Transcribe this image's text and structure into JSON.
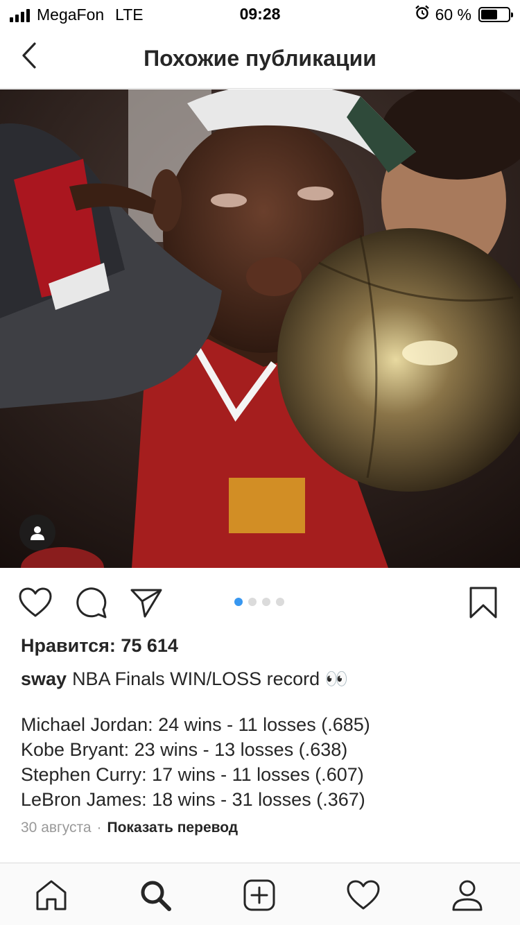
{
  "status_bar": {
    "carrier": "MegaFon",
    "network": "LTE",
    "time": "09:28",
    "battery": "60 %"
  },
  "nav": {
    "title": "Похожие публикации"
  },
  "post": {
    "image_dots": {
      "count": 4,
      "active_index": 0
    },
    "likes": "Нравится: 75 614",
    "username": "sway",
    "caption": "NBA Finals WIN/LOSS record 👀",
    "stats": [
      "Michael Jordan: 24 wins - 11 losses (.685)",
      "Kobe Bryant: 23 wins - 13 losses (.638)",
      "Stephen Curry: 17 wins - 11 losses (.607)",
      "LeBron James: 18 wins - 31 losses (.367)"
    ],
    "date": "30 августа",
    "separator": "·",
    "translate_label": "Показать перевод"
  },
  "colors": {
    "accent_dot": "#3897f0",
    "text": "#262626",
    "muted": "#999999",
    "divider": "#dbdbdb"
  },
  "icons": {
    "nav": [
      "back-icon"
    ],
    "actions": [
      "heart-icon",
      "comment-icon",
      "share-icon",
      "bookmark-icon"
    ],
    "tabs": [
      "home-icon",
      "search-icon",
      "add-icon",
      "heart-icon",
      "profile-icon"
    ]
  }
}
